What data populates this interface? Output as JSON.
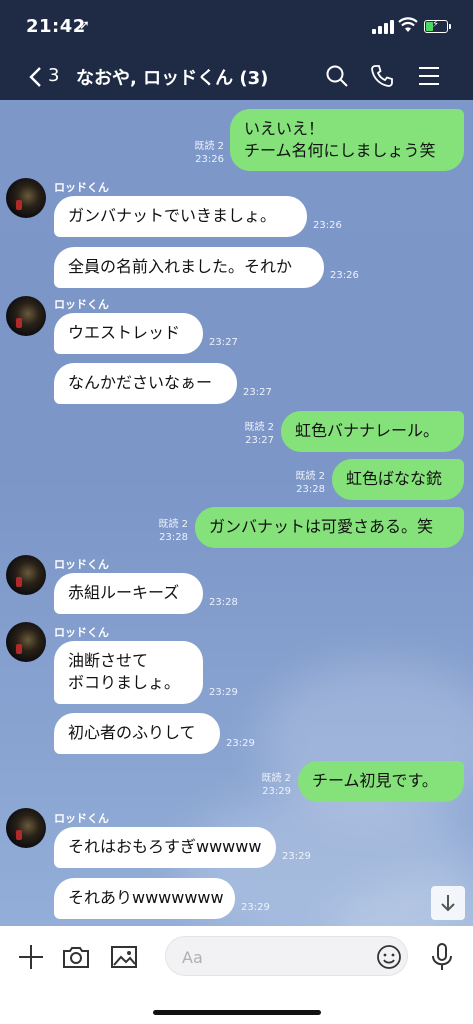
{
  "status_bar": {
    "time": "21:42",
    "location_icon": "location-arrow-icon"
  },
  "header": {
    "back_count": "3",
    "title": "なおや, ロッドくん (3)",
    "icons": [
      "search-icon",
      "phone-icon",
      "menu-icon"
    ]
  },
  "colors": {
    "header_bg": "#1f2a44",
    "my_bubble": "#85e27a",
    "their_bubble": "#ffffff",
    "battery": "#4cd964"
  },
  "messages": [
    {
      "from": "me",
      "text": "いえいえ！\nチーム名何にしましょう笑",
      "read": "既読 2",
      "time": "23:26"
    },
    {
      "from": "them",
      "sender": "ロッドくん",
      "text": "ガンバナットでいきましょ。",
      "time": "23:26"
    },
    {
      "from": "them",
      "text": "全員の名前入れました。それか",
      "time": "23:26"
    },
    {
      "from": "them",
      "sender": "ロッドくん",
      "text": "ウエストレッド",
      "time": "23:27"
    },
    {
      "from": "them",
      "text": "なんかださいなぁー",
      "time": "23:27"
    },
    {
      "from": "me",
      "text": "虹色バナナレール。",
      "read": "既読 2",
      "time": "23:27"
    },
    {
      "from": "me",
      "text": "虹色ばなな銃",
      "read": "既読 2",
      "time": "23:28"
    },
    {
      "from": "me",
      "text": "ガンバナットは可愛さある。笑",
      "read": "既読 2",
      "time": "23:28"
    },
    {
      "from": "them",
      "sender": "ロッドくん",
      "text": "赤組ルーキーズ",
      "time": "23:28"
    },
    {
      "from": "them",
      "sender": "ロッドくん",
      "text": "油断させて\nボコりましょ。",
      "time": "23:29"
    },
    {
      "from": "them",
      "text": "初心者のふりして",
      "time": "23:29"
    },
    {
      "from": "me",
      "text": "チーム初見です。",
      "read": "既読 2",
      "time": "23:29"
    },
    {
      "from": "them",
      "sender": "ロッドくん",
      "text": "それはおもろすぎwwwww",
      "time": "23:29"
    },
    {
      "from": "them",
      "text": "それありwwwwwww",
      "time": "23:29"
    }
  ],
  "input": {
    "placeholder": "Aa"
  },
  "bottom_icons": [
    "plus-icon",
    "camera-icon",
    "image-icon",
    "emoji-icon",
    "microphone-icon"
  ]
}
